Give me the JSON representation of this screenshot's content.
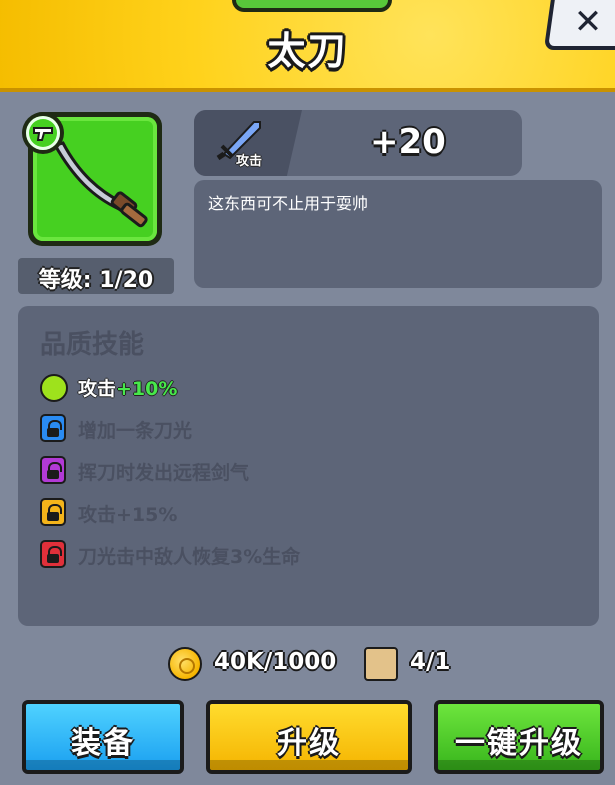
{
  "header": {
    "title": "太刀"
  },
  "weapon": {
    "name": "太刀",
    "level_text": "等级: 1/20",
    "rarity_color": "#46d021"
  },
  "stat": {
    "label": "攻击",
    "value": "+20",
    "icon": "sword-icon"
  },
  "description": "这东西可不止用于耍帅",
  "skills": {
    "title": "品质技能",
    "items": [
      {
        "prefix": "攻击",
        "highlight": "+10%",
        "unlocked": true,
        "color": "#9ee21c"
      },
      {
        "text": "增加一条刀光",
        "unlocked": false,
        "color": "#2a8bf2"
      },
      {
        "text": "挥刀时发出远程剑气",
        "unlocked": false,
        "color": "#b23ad6"
      },
      {
        "text": "攻击+15%",
        "unlocked": false,
        "color": "#f4b41a"
      },
      {
        "text": "刀光击中敌人恢复3%生命",
        "unlocked": false,
        "color": "#e0303a"
      }
    ]
  },
  "costs": {
    "gold": "40K/1000",
    "scroll": "4/1"
  },
  "buttons": {
    "equip": "装备",
    "upgrade": "升级",
    "one_click": "一键升级"
  }
}
